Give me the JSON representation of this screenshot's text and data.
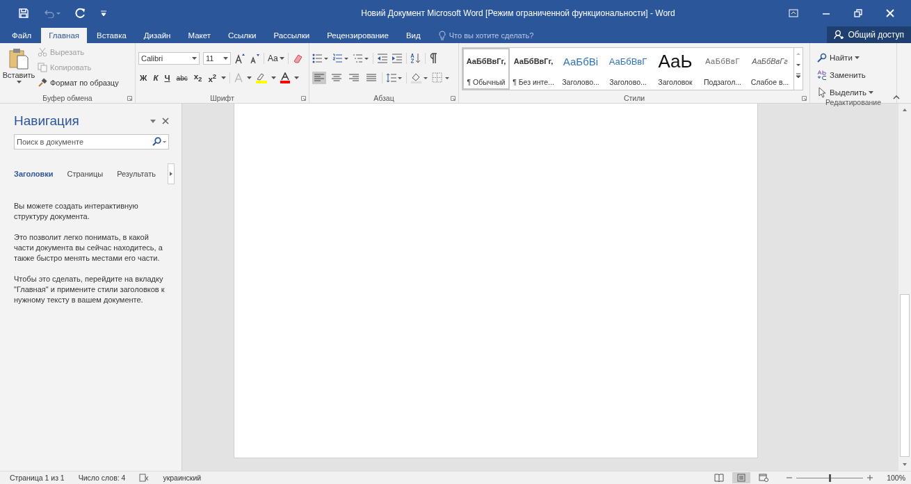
{
  "window": {
    "title": "Новий Документ Microsoft Word [Режим ограниченной функциональности] - Word",
    "undo_disabled": true
  },
  "tabs": [
    {
      "label": "Файл",
      "selected": false
    },
    {
      "label": "Главная",
      "selected": true
    },
    {
      "label": "Вставка",
      "selected": false
    },
    {
      "label": "Дизайн",
      "selected": false
    },
    {
      "label": "Макет",
      "selected": false
    },
    {
      "label": "Ссылки",
      "selected": false
    },
    {
      "label": "Рассылки",
      "selected": false
    },
    {
      "label": "Рецензирование",
      "selected": false
    },
    {
      "label": "Вид",
      "selected": false
    }
  ],
  "tell_me": {
    "placeholder": "Что вы хотите сделать?"
  },
  "share_button": "Общий доступ",
  "clipboard": {
    "paste": "Вставить",
    "group_label": "Буфер обмена",
    "items": [
      {
        "kind": "cut",
        "label": "Вырезать",
        "disabled": true
      },
      {
        "kind": "copy",
        "label": "Копировать",
        "disabled": true
      },
      {
        "kind": "format",
        "label": "Формат по образцу",
        "disabled": false
      }
    ]
  },
  "font": {
    "name": "Calibri",
    "size": "11",
    "case_button": "Aa",
    "group_label": "Шрифт",
    "format_buttons": [
      "Ж",
      "К",
      "Ч",
      "abc",
      "x$_{2}$",
      "x$^{2}$"
    ]
  },
  "paragraph": {
    "group_label": "Абзац",
    "align": [
      {
        "selected": true
      },
      {
        "selected": false
      },
      {
        "selected": false
      },
      {
        "selected": false
      }
    ]
  },
  "styles": {
    "group_label": "Стили",
    "items": [
      {
        "kind": "normal",
        "sample": "АаБбВвГг,",
        "label": "¶ Обычный",
        "selected": true
      },
      {
        "kind": "no-spacing",
        "sample": "АаБбВвГг,",
        "label": "¶ Без инте...",
        "selected": false
      },
      {
        "kind": "heading1",
        "sample": "АаБбВі",
        "label": "Заголово...",
        "selected": false
      },
      {
        "kind": "heading2",
        "sample": "АаБбВвГ",
        "label": "Заголово...",
        "selected": false
      },
      {
        "kind": "title",
        "sample": "АаЬ",
        "label": "Заголовок",
        "selected": false
      },
      {
        "kind": "subtitle",
        "sample": "АаБбВвГ",
        "label": "Подзагол...",
        "selected": false
      },
      {
        "kind": "subtle",
        "sample": "АаБбВвГг",
        "label": "Слабое в...",
        "selected": false
      }
    ]
  },
  "editing": {
    "group_label": "Редактирование",
    "items": [
      {
        "kind": "find",
        "label": "Найти"
      },
      {
        "kind": "replace",
        "label": "Заменить"
      },
      {
        "kind": "select",
        "label": "Выделить"
      }
    ]
  },
  "navigation": {
    "title": "Навигация",
    "search": {
      "placeholder": "Поиск в документе"
    },
    "tabs": [
      {
        "label": "Заголовки",
        "selected": true
      },
      {
        "label": "Страницы",
        "selected": false
      },
      {
        "label": "Результать",
        "selected": false
      }
    ],
    "paragraphs": [
      "Вы можете создать интерактивную структуру документа.",
      "Это позволит легко понимать, в какой части документа вы сейчас находитесь, а также быстро менять местами его части.",
      "Чтобы это сделать, перейдите на вкладку \"Главная\" и примените стили заголовков к нужному тексту в вашем документе."
    ]
  },
  "status_bar": {
    "page": "Страница 1 из 1",
    "words": "Число слов: 4",
    "language": "украинский",
    "views": [
      {
        "selected": false
      },
      {
        "selected": true
      },
      {
        "selected": false
      }
    ],
    "zoom": {
      "level": 0.5,
      "label": "100%"
    }
  }
}
